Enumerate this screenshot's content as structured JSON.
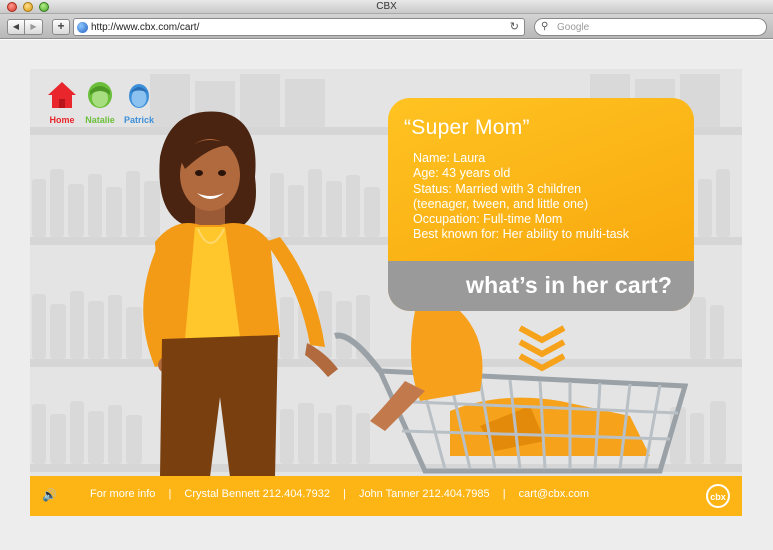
{
  "window": {
    "title": "CBX"
  },
  "toolbar": {
    "back_label": "◀",
    "forward_label": "▶",
    "add_label": "+",
    "url": "http://www.cbx.com/cart/",
    "reload_label": "↻",
    "search_placeholder": "Google"
  },
  "nav": [
    {
      "label": "Home",
      "color": "#e8262b",
      "icon": "house-icon"
    },
    {
      "label": "Natalie",
      "color": "#6bbf3a",
      "icon": "girl-head-icon"
    },
    {
      "label": "Patrick",
      "color": "#3c8fd8",
      "icon": "boy-head-icon"
    }
  ],
  "profile": {
    "title": "“Super Mom”",
    "lines": [
      "Name:  Laura",
      "Age:  43 years old",
      "Status:  Married with 3 children",
      "(teenager, tween, and little one)",
      "Occupation:  Full-time Mom",
      "Best known for:  Her ability to multi-task"
    ],
    "cart_question": "what’s in her cart?"
  },
  "footer": {
    "speaker": "🔊",
    "for_more_info": "For more info",
    "sep": "|",
    "contact_1": "Crystal Bennett 212.404.7932",
    "contact_2": "John Tanner 212.404.7985",
    "email": "cart@cbx.com",
    "logo_text": "cbx"
  },
  "colors": {
    "accent": "#fdb515",
    "card": "#f9ad12",
    "band": "#9a9a9a"
  }
}
